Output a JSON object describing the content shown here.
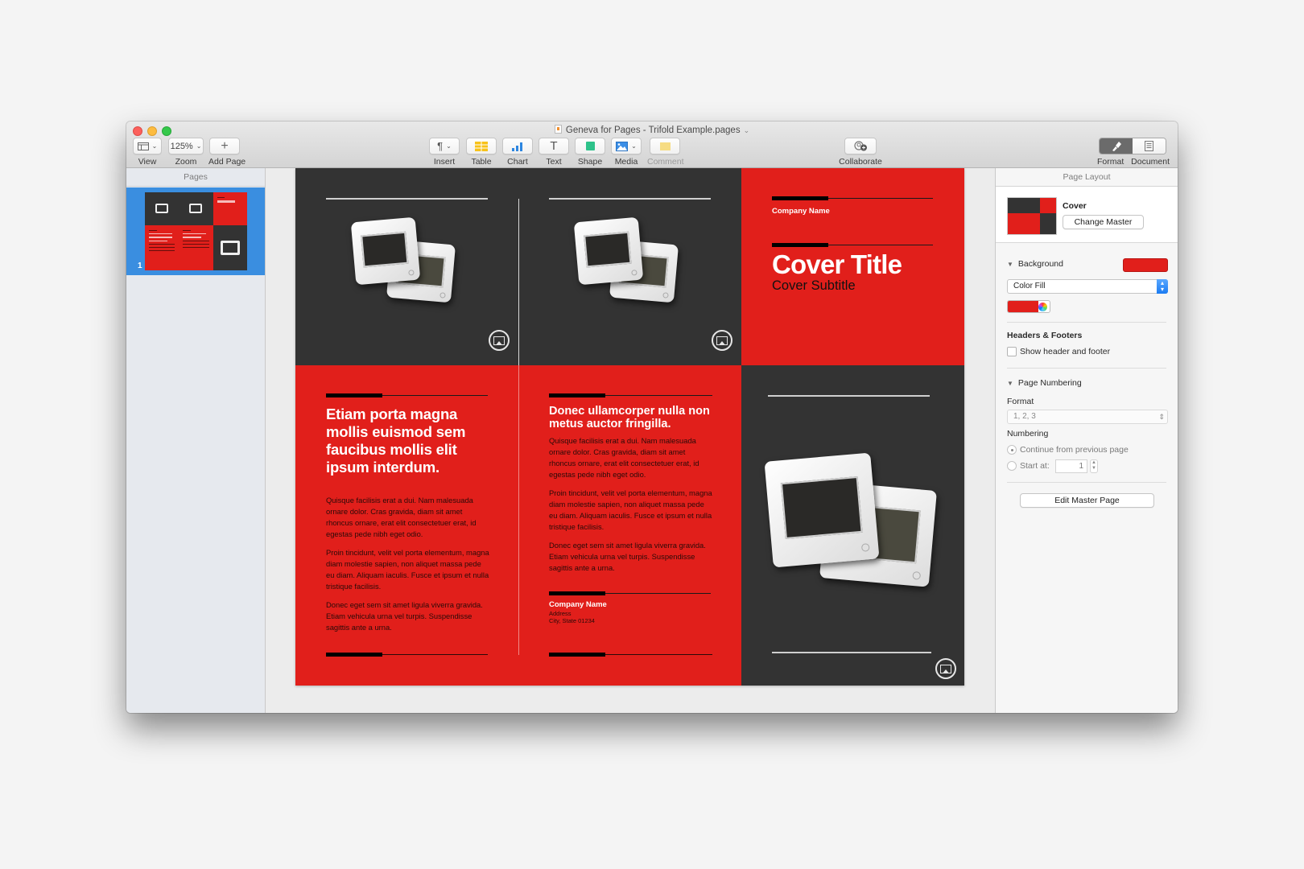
{
  "window": {
    "title": "Geneva for Pages - Trifold Example.pages"
  },
  "toolbar": {
    "view_label": "View",
    "zoom_value": "125%",
    "zoom_label": "Zoom",
    "add_page_label": "Add Page",
    "insert_label": "Insert",
    "table_label": "Table",
    "chart_label": "Chart",
    "text_label": "Text",
    "shape_label": "Shape",
    "media_label": "Media",
    "comment_label": "Comment",
    "collaborate_label": "Collaborate",
    "format_label": "Format",
    "document_label": "Document",
    "icons": {
      "insert": "pilcrow-icon",
      "text": "T"
    }
  },
  "sidebar": {
    "title": "Pages",
    "pages": [
      {
        "number": "1",
        "selected": true
      }
    ]
  },
  "document": {
    "colors": {
      "red": "#e11f1b",
      "dark": "#333333"
    },
    "panel_left": {
      "heading": "Etiam porta magna mollis euismod sem faucibus mollis elit ipsum interdum.",
      "paragraphs": [
        "Quisque facilisis erat a dui. Nam malesuada ornare dolor. Cras gravida, diam sit amet rhoncus ornare, erat elit consectetuer erat, id egestas pede nibh eget odio.",
        "Proin tincidunt, velit vel porta elementum, magna diam molestie sapien, non aliquet massa pede eu diam. Aliquam iaculis. Fusce et ipsum et nulla tristique facilisis.",
        "Donec eget sem sit amet ligula viverra gravida. Etiam vehicula urna vel turpis. Suspendisse sagittis ante a urna."
      ]
    },
    "panel_middle": {
      "heading": "Donec ullamcorper nulla non metus auctor fringilla.",
      "paragraphs": [
        "Quisque facilisis erat a dui. Nam malesuada ornare dolor. Cras gravida, diam sit amet rhoncus ornare, erat elit consectetuer erat, id egestas pede nibh eget odio.",
        "Proin tincidunt, velit vel porta elementum, magna diam molestie sapien, non aliquet massa pede eu diam. Aliquam iaculis. Fusce et ipsum et nulla tristique facilisis.",
        "Donec eget sem sit amet ligula viverra gravida. Etiam vehicula urna vel turpis. Suspendisse sagittis ante a urna."
      ],
      "company_name": "Company Name",
      "address": "Address",
      "city_state": "City, State 01234"
    },
    "cover": {
      "company_name": "Company Name",
      "title": "Cover Title",
      "subtitle": "Cover Subtitle"
    }
  },
  "inspector": {
    "title": "Page Layout",
    "master_name": "Cover",
    "change_master_label": "Change Master",
    "background_label": "Background",
    "background_color": "#e11f1b",
    "fill_type": "Color Fill",
    "headers_footers_label": "Headers & Footers",
    "show_header_footer_label": "Show header and footer",
    "show_header_footer_checked": false,
    "page_numbering_label": "Page Numbering",
    "format_label": "Format",
    "format_value": "1, 2, 3",
    "numbering_label": "Numbering",
    "continue_label": "Continue from previous page",
    "continue_selected": true,
    "start_at_label": "Start at:",
    "start_at_value": "1",
    "edit_master_label": "Edit Master Page"
  }
}
